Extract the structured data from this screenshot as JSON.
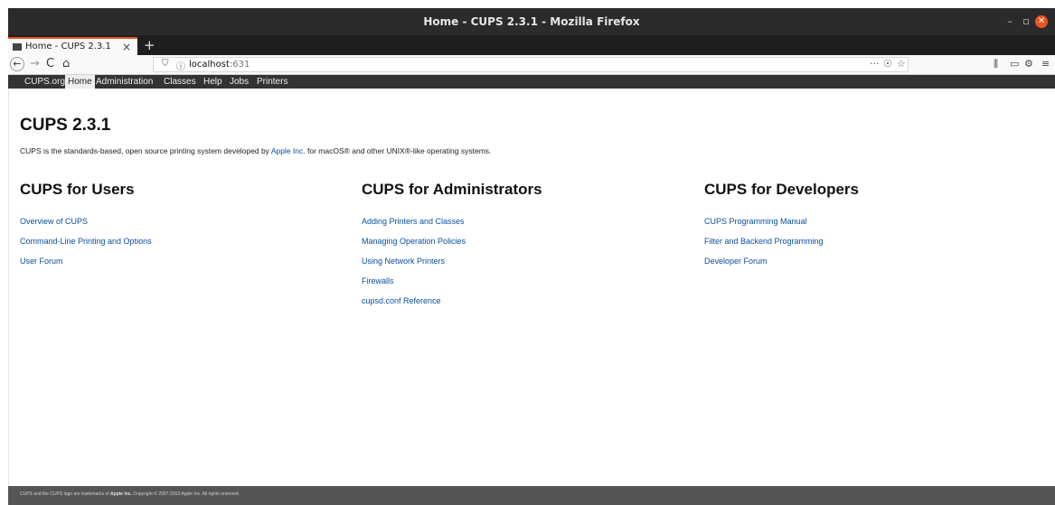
{
  "window": {
    "title": "Home - CUPS 2.3.1 - Mozilla Firefox",
    "minimize": "–",
    "maximize": "▫",
    "close": "✕"
  },
  "tab": {
    "label": "Home - CUPS 2.3.1",
    "close": "×",
    "new_tab": "+"
  },
  "navbar": {
    "back": "←",
    "forward": "→",
    "reload": "C",
    "home": "⌂",
    "url_host": "localhost",
    "url_port": ":631",
    "shield": "⛉",
    "info": "ⓘ",
    "more": "···",
    "pocket": "☉",
    "star": "☆",
    "library": "⫼",
    "sidebar": "▭",
    "extension": "⚙",
    "menu": "≡"
  },
  "cups_nav": [
    {
      "label": "CUPS.org",
      "active": false
    },
    {
      "label": "Home",
      "active": true
    },
    {
      "label": "Administration",
      "active": false
    },
    {
      "label": "Classes",
      "active": false
    },
    {
      "label": "Help",
      "active": false
    },
    {
      "label": "Jobs",
      "active": false
    },
    {
      "label": "Printers",
      "active": false
    }
  ],
  "main": {
    "title": "CUPS 2.3.1",
    "intro_before": "CUPS is the standards-based, open source printing system developed by ",
    "intro_link": "Apple Inc.",
    "intro_after": " for macOS® and other UNIX®-like operating systems."
  },
  "columns": {
    "users": {
      "heading": "CUPS for Users",
      "links": [
        "Overview of CUPS",
        "Command-Line Printing and Options",
        "User Forum"
      ]
    },
    "admins": {
      "heading": "CUPS for Administrators",
      "links": [
        "Adding Printers and Classes",
        "Managing Operation Policies",
        "Using Network Printers",
        "Firewalls",
        "cupsd.conf Reference"
      ]
    },
    "developers": {
      "heading": "CUPS for Developers",
      "links": [
        "CUPS Programming Manual",
        "Filter and Backend Programming",
        "Developer Forum"
      ]
    }
  },
  "footer": {
    "before": "CUPS and the CUPS logo are trademarks of ",
    "company": "Apple Inc.",
    "after": " Copyright © 2007-2019 Apple Inc. All rights reserved."
  }
}
